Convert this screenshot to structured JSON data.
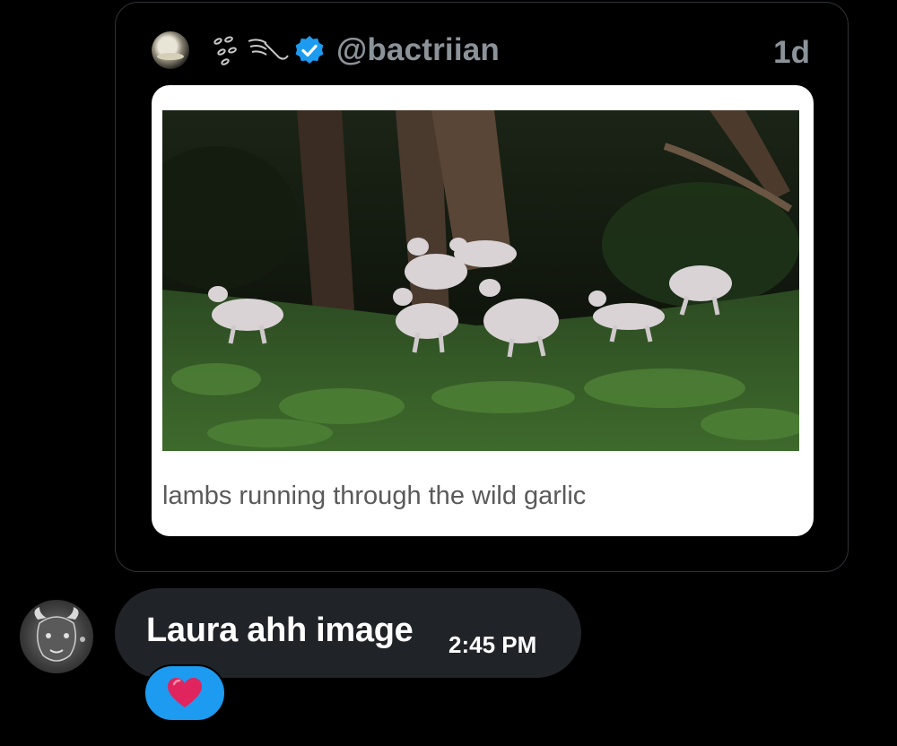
{
  "quoted_post": {
    "handle": "@bactriian",
    "age": "1d",
    "media_caption": "lambs running through the wild garlic",
    "verified": true
  },
  "message": {
    "text": "Laura ahh image",
    "time": "2:45 PM"
  },
  "reaction": {
    "icon": "red-heart-icon"
  },
  "colors": {
    "background": "#000000",
    "bubble": "#202327",
    "accent": "#1d9bf0",
    "muted_text": "#8b9399",
    "heart": "#e0245e"
  }
}
